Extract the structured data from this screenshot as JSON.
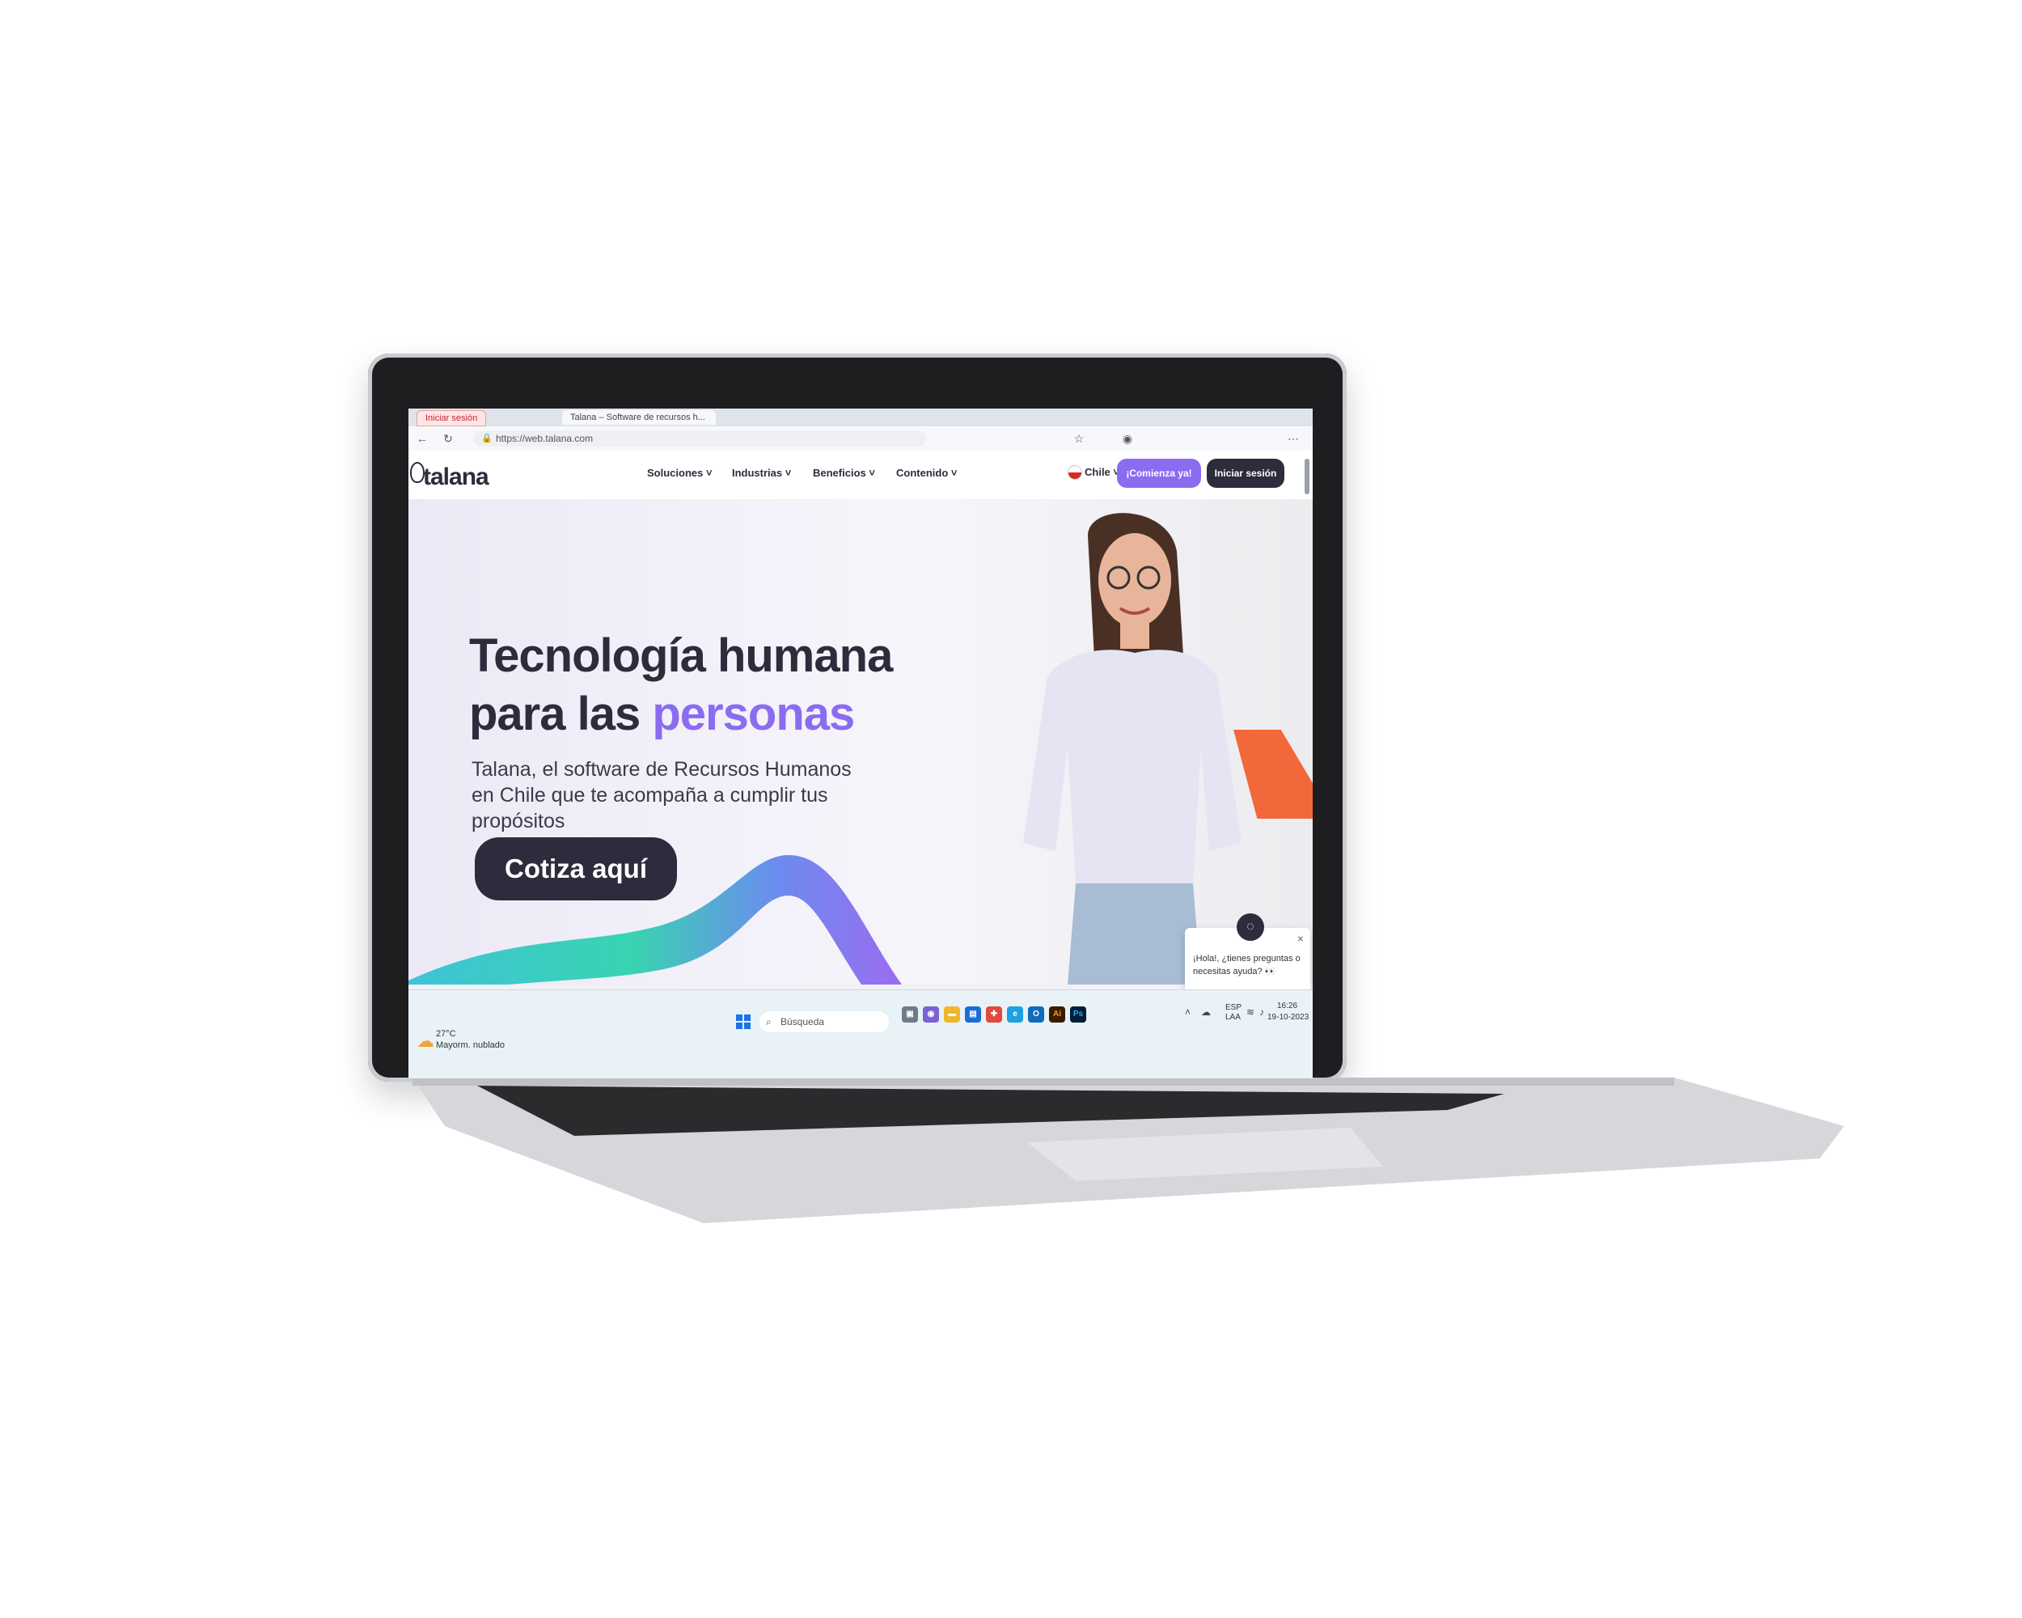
{
  "browser": {
    "tab1": "Iniciar sesión",
    "tab2": "Talana – Software de recursos h...",
    "url": "https://web.talana.com"
  },
  "site": {
    "logo": "talana",
    "menu": [
      "Soluciones ˅",
      "Industrias ˅",
      "Beneficios ˅",
      "Contenido ˅"
    ],
    "country": "Chile ˅",
    "start_button": "¡Comienza ya!",
    "login_button": "Iniciar sesión"
  },
  "hero": {
    "title_line1": "Tecnología humana",
    "title_line2_prefix": "para las ",
    "title_line2_accent": "personas",
    "subtitle": "Talana, el software de Recursos Humanos en Chile que te acompaña a cumplir tus propósitos",
    "cta": "Cotiza aquí"
  },
  "chat": {
    "message": "¡Hola!, ¿tienes preguntas o necesitas ayuda? 👀",
    "close": "×"
  },
  "taskbar": {
    "temperature": "27°C",
    "weather": "Mayorm. nublado",
    "search_placeholder": "Búsqueda",
    "lang_line1": "ESP",
    "lang_line2": "LAA",
    "time": "16:26",
    "date": "19-10-2023"
  },
  "colors": {
    "brand_dark": "#2d2c3c",
    "brand_purple": "#8b6cf0",
    "accent_orange": "#f2683a"
  }
}
